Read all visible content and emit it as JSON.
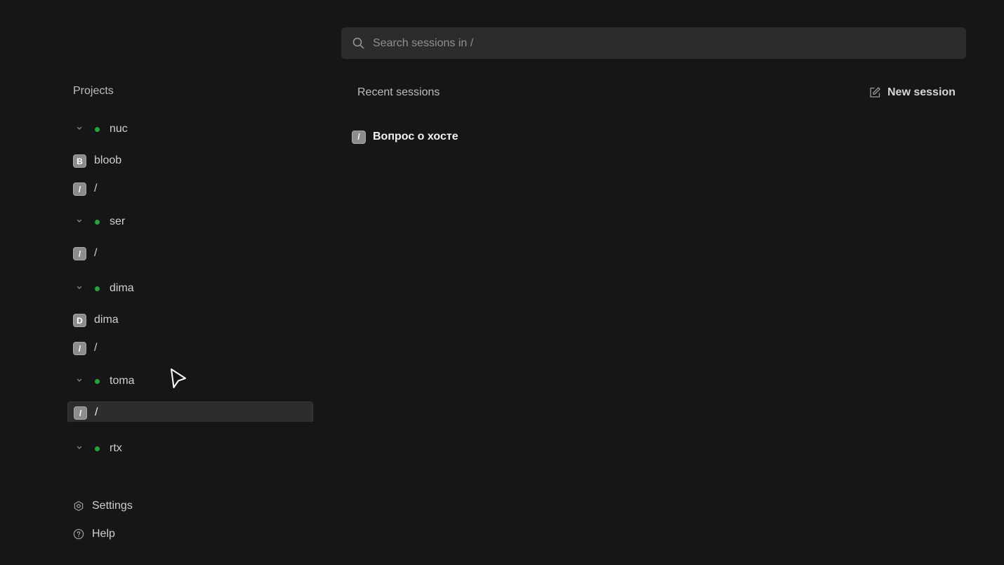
{
  "search": {
    "placeholder": "Search sessions in /",
    "value": ""
  },
  "sidebar": {
    "projects_title": "Projects",
    "hosts": [
      {
        "name": "nuc",
        "status_color": "#22a83a",
        "projects": [
          {
            "badge": "B",
            "name": "bloob"
          },
          {
            "badge": "/",
            "name": "/"
          }
        ]
      },
      {
        "name": "ser",
        "status_color": "#22a83a",
        "projects": [
          {
            "badge": "/",
            "name": "/"
          }
        ]
      },
      {
        "name": "dima",
        "status_color": "#22a83a",
        "projects": [
          {
            "badge": "D",
            "name": "dima"
          },
          {
            "badge": "/",
            "name": "/"
          }
        ]
      },
      {
        "name": "toma",
        "status_color": "#22a83a",
        "projects": [
          {
            "badge": "/",
            "name": "/",
            "selected": true
          }
        ]
      },
      {
        "name": "rtx",
        "status_color": "#22a83a",
        "projects": []
      }
    ],
    "footer": [
      {
        "icon": "settings-icon",
        "label": "Settings"
      },
      {
        "icon": "help-icon",
        "label": "Help"
      }
    ]
  },
  "main": {
    "recent_title": "Recent sessions",
    "new_session_label": "New session",
    "sessions": [
      {
        "badge": "/",
        "title": "Вопрос о хосте"
      }
    ]
  },
  "colors": {
    "background": "#161616",
    "status_online": "#22a83a",
    "badge": "#8c8c8c"
  }
}
